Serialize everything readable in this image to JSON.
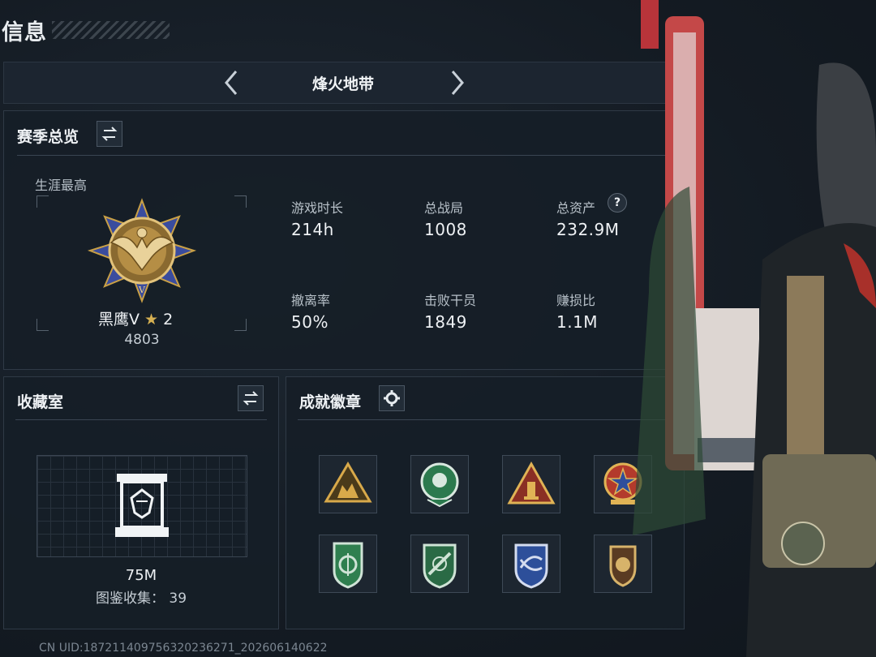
{
  "header": {
    "title": "信息"
  },
  "mode_tabs": {
    "current": "烽火地带"
  },
  "season": {
    "title": "赛季总览",
    "peak_label": "生涯最高",
    "rank_name": "黑鹰Ⅴ",
    "rank_stars": "2",
    "rank_points": "4803",
    "stats": [
      {
        "label": "游戏时长",
        "value": "214h"
      },
      {
        "label": "总战局",
        "value": "1008"
      },
      {
        "label": "总资产",
        "value": "232.9M"
      },
      {
        "label": "撤离率",
        "value": "50%"
      },
      {
        "label": "击败干员",
        "value": "1849"
      },
      {
        "label": "赚损比",
        "value": "1.1M"
      }
    ]
  },
  "collection": {
    "title": "收藏室",
    "value": "75M",
    "catalog_label": "图鉴收集：",
    "catalog_count": "39"
  },
  "badges": {
    "title": "成就徽章",
    "items": [
      "badge-soldiers-triangle",
      "badge-green-laurel",
      "badge-gold-triangle",
      "badge-red-star-shield",
      "badge-green-target-shield",
      "badge-green-rifle-shield",
      "badge-blue-wing-shield",
      "badge-lion-shield"
    ]
  },
  "footer": {
    "uid": "CN UID:187211409756320236271_202606140622"
  },
  "colors": {
    "accent_gold": "#c9a046",
    "panel_bg": "#161e27",
    "border": "#2f3a46",
    "text": "#eef1f4"
  }
}
